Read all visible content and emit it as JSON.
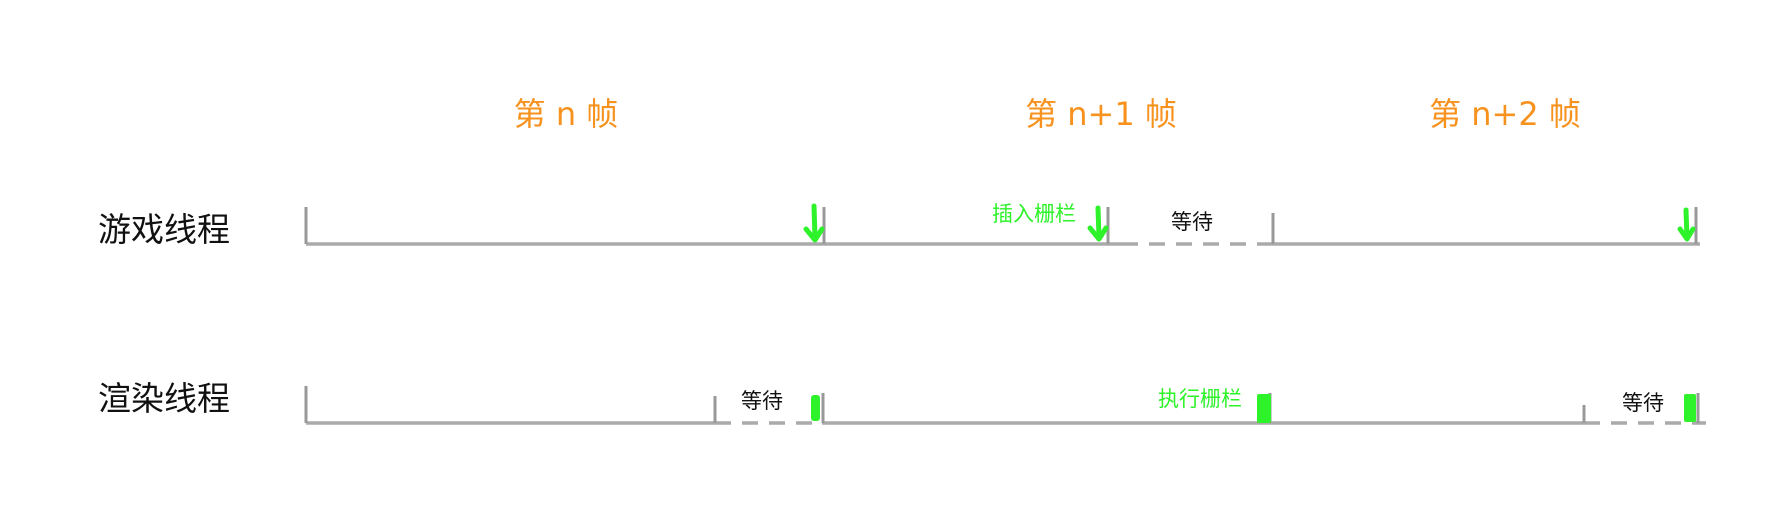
{
  "colors": {
    "frame_label": "#f7921e",
    "axis": "#aaaaaa",
    "tick": "#999999",
    "green": "#2ef22a",
    "text": "#111111"
  },
  "frames": [
    {
      "label": "第 n 帧"
    },
    {
      "label": "第 n+1 帧"
    },
    {
      "label": "第 n+2 帧"
    }
  ],
  "rows": {
    "game": {
      "label": "游戏线程",
      "wait_label": "等待",
      "fence_label": "插入栅栏",
      "fence_icon": "green-down-arrow-icon"
    },
    "render": {
      "label": "渲染线程",
      "wait_labels": [
        "等待",
        "等待"
      ],
      "fence_label": "执行栅栏",
      "fence_icon": "green-bar-marker-icon"
    }
  }
}
